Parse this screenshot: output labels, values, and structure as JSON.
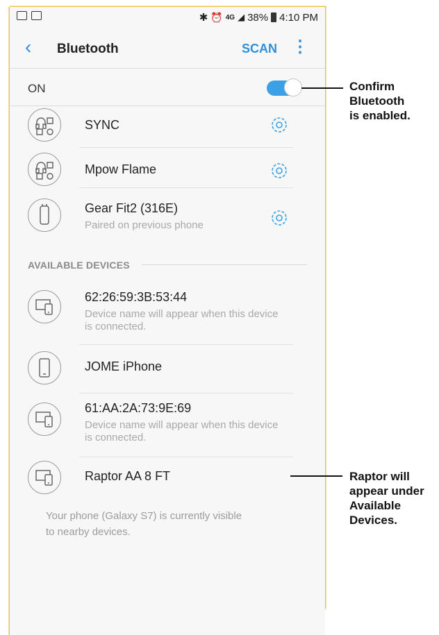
{
  "status_bar": {
    "signal_text": "4G",
    "battery": "38%",
    "time": "4:10 PM"
  },
  "app_bar": {
    "title": "Bluetooth",
    "scan_label": "SCAN"
  },
  "bluetooth_toggle": {
    "label": "ON",
    "enabled": true
  },
  "paired_devices": [
    {
      "name": "SYNC",
      "subtitle": "",
      "icon": "headphones-icon"
    },
    {
      "name": "Mpow Flame",
      "subtitle": "",
      "icon": "headphones-icon"
    },
    {
      "name": "Gear Fit2 (316E)",
      "subtitle": "Paired on previous phone",
      "icon": "watch-icon"
    }
  ],
  "available_section_label": "AVAILABLE DEVICES",
  "available_devices": [
    {
      "name": "62:26:59:3B:53:44",
      "subtitle_line1": "Device name will appear when this device",
      "subtitle_line2": "is connected.",
      "icon": "devices-icon"
    },
    {
      "name": "JOME iPhone",
      "subtitle_line1": "",
      "subtitle_line2": "",
      "icon": "phone-icon"
    },
    {
      "name": "61:AA:2A:73:9E:69",
      "subtitle_line1": "Device name will appear when this device",
      "subtitle_line2": "is connected.",
      "icon": "devices-icon"
    },
    {
      "name": "Raptor AA 8 FT",
      "subtitle_line1": "",
      "subtitle_line2": "",
      "icon": "devices-icon"
    }
  ],
  "footer": {
    "line1": "Your phone (Galaxy S7) is currently visible",
    "line2": "to nearby devices."
  },
  "callouts": {
    "top": [
      "Confirm",
      "Bluetooth",
      "is enabled."
    ],
    "bottom": [
      "Raptor will",
      "appear under",
      "Available",
      "Devices."
    ]
  },
  "colors": {
    "accent": "#2f8fd8",
    "frame": "#e8c54a",
    "background": "#f7f7f7"
  }
}
